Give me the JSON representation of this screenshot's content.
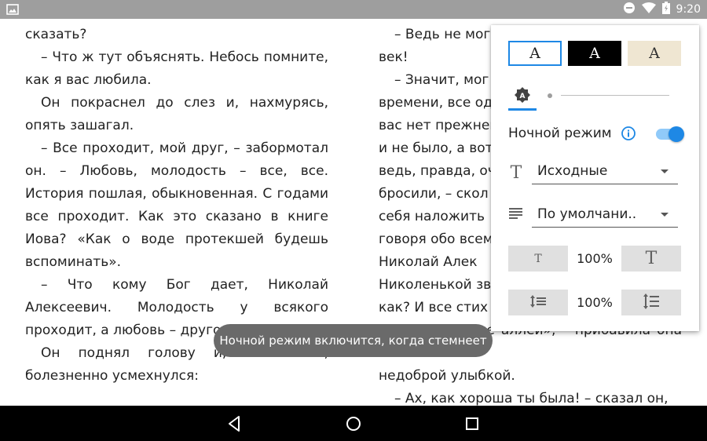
{
  "status_bar": {
    "time": "9:20",
    "icons": [
      "image-icon",
      "do-not-disturb-icon",
      "wifi-icon",
      "battery-icon"
    ]
  },
  "left_page": {
    "paragraphs": [
      {
        "text": "сказать?",
        "indent": false
      },
      {
        "text": "– Что ж тут объяснять. Небось помните, как я вас любила.",
        "indent": true
      },
      {
        "text": "Он покраснел до слез и, нахмурясь, опять зашагал.",
        "indent": true
      },
      {
        "text": "– Все проходит, мой друг, – забормотал он. – Любовь, молодость – все, все. История пошлая, обыкновенная. С годами все проходит. Как это сказано в книге Иова? «Как о воде протекшей будешь вспоминать».",
        "indent": true
      },
      {
        "text": "– Что кому Бог дает, Николай Алексеевич. Молодость у всякого проходит, а любовь – другое дело.",
        "indent": true
      },
      {
        "text": "Он поднял голову и, остановясь, болезненно усмехнулся:",
        "indent": true
      }
    ]
  },
  "right_page": {
    "paragraphs": [
      {
        "text": "– Ведь не мог",
        "indent": true
      },
      {
        "text": "век!",
        "indent": false
      },
      {
        "text": "– Значит, мог",
        "indent": true
      },
      {
        "text": "времени, все од",
        "indent": false
      },
      {
        "text": "вас нет прежнего",
        "indent": false
      },
      {
        "text": "и не было, а вот",
        "indent": false
      },
      {
        "text": "ведь, правда, оч",
        "indent": false
      },
      {
        "text": "бросили, – скол",
        "indent": false
      },
      {
        "text": "себя наложить",
        "indent": false
      },
      {
        "text": "говоря обо всем",
        "indent": false
      },
      {
        "text": "Николай Алек",
        "indent": false
      },
      {
        "text": "Николенькой зв",
        "indent": false
      },
      {
        "text": "как? И все стих",
        "indent": false
      },
      {
        "text": "всякие «темные аллеи», – прибавила она с",
        "indent": false
      },
      {
        "text": "недоброй улыбкой.",
        "indent": false
      },
      {
        "text": "– Ах, как хороша ты была! – сказал он,",
        "indent": true
      }
    ]
  },
  "settings_panel": {
    "themes": [
      {
        "label": "A",
        "name": "white",
        "selected": true
      },
      {
        "label": "A",
        "name": "black",
        "selected": false
      },
      {
        "label": "A",
        "name": "sepia",
        "selected": false
      }
    ],
    "brightness_auto_label": "A",
    "night_mode_label": "Ночной режим",
    "night_mode_enabled": true,
    "font_dropdown_value": "Исходные",
    "font_icon_glyph": "T",
    "align_dropdown_value": "По умолчани..",
    "font_size_small_label": "T",
    "font_size_large_label": "T",
    "font_size_value": "100%",
    "line_spacing_value": "100%"
  },
  "toast": {
    "text": "Ночной режим включится, когда стемнеет"
  },
  "colors": {
    "accent": "#1e88e5",
    "status_bar": "#9e9e9e",
    "toast_bg": "#6a6a6a",
    "sepia": "#efe6d2"
  }
}
